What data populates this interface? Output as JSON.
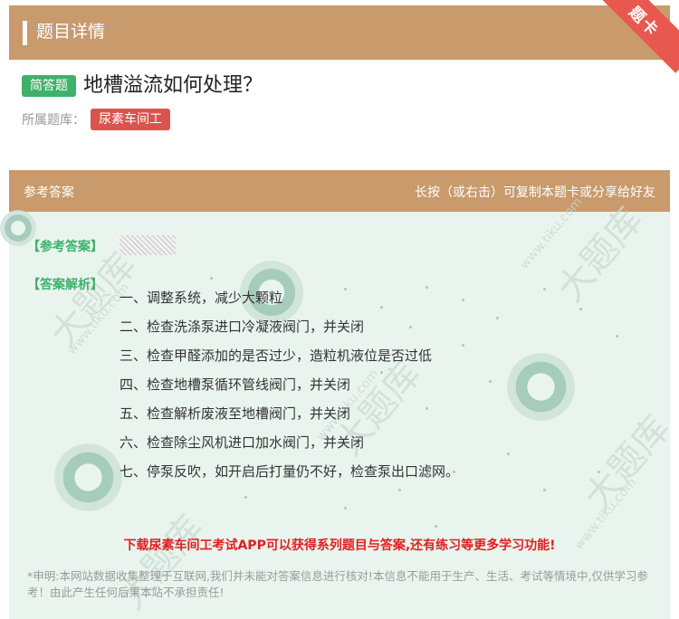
{
  "header": {
    "title": "题目详情",
    "ribbon": "题卡"
  },
  "question": {
    "type_badge": "简答题",
    "text": "地槽溢流如何处理？"
  },
  "bank": {
    "label": "所属题库：",
    "name": "尿素车间工"
  },
  "answer_card": {
    "header_left": "参考答案",
    "header_right": "长按（或右击）可复制本题卡或分享给好友",
    "ref_label": "【参考答案】",
    "analysis_label": "【答案解析】",
    "steps": [
      "一、调整系统，减少大颗粒",
      "二、检查洗涤泵进口冷凝液阀门，并关闭",
      "三、检查甲醛添加的是否过少，造粒机液位是否过低",
      "四、检查地槽泵循环管线阀门，并关闭",
      "五、检查解析废液至地槽阀门，并关闭",
      "六、检查除尘风机进口加水阀门，并关闭",
      "七、停泵反吹，如开启后打量仍不好，检查泵出口滤网。"
    ]
  },
  "promo": "下载尿素车间工考试APP可以获得系列题目与答案,还有练习等更多学习功能!",
  "disclaimer": "*申明:本网站数据收集整理于互联网,我们并未能对答案信息进行核对!本信息不能用于生产、生活、考试等情境中,仅供学习参考！由此产生任何后果本站不承担责任!",
  "colors": {
    "header_bg": "#c89a6c",
    "answer_bg": "#eaf4ef",
    "green": "#3eb16b",
    "red": "#d9534f",
    "promo_red": "#e02020"
  },
  "watermark": {
    "brand": "大题库",
    "url": "www.tiku.com"
  }
}
